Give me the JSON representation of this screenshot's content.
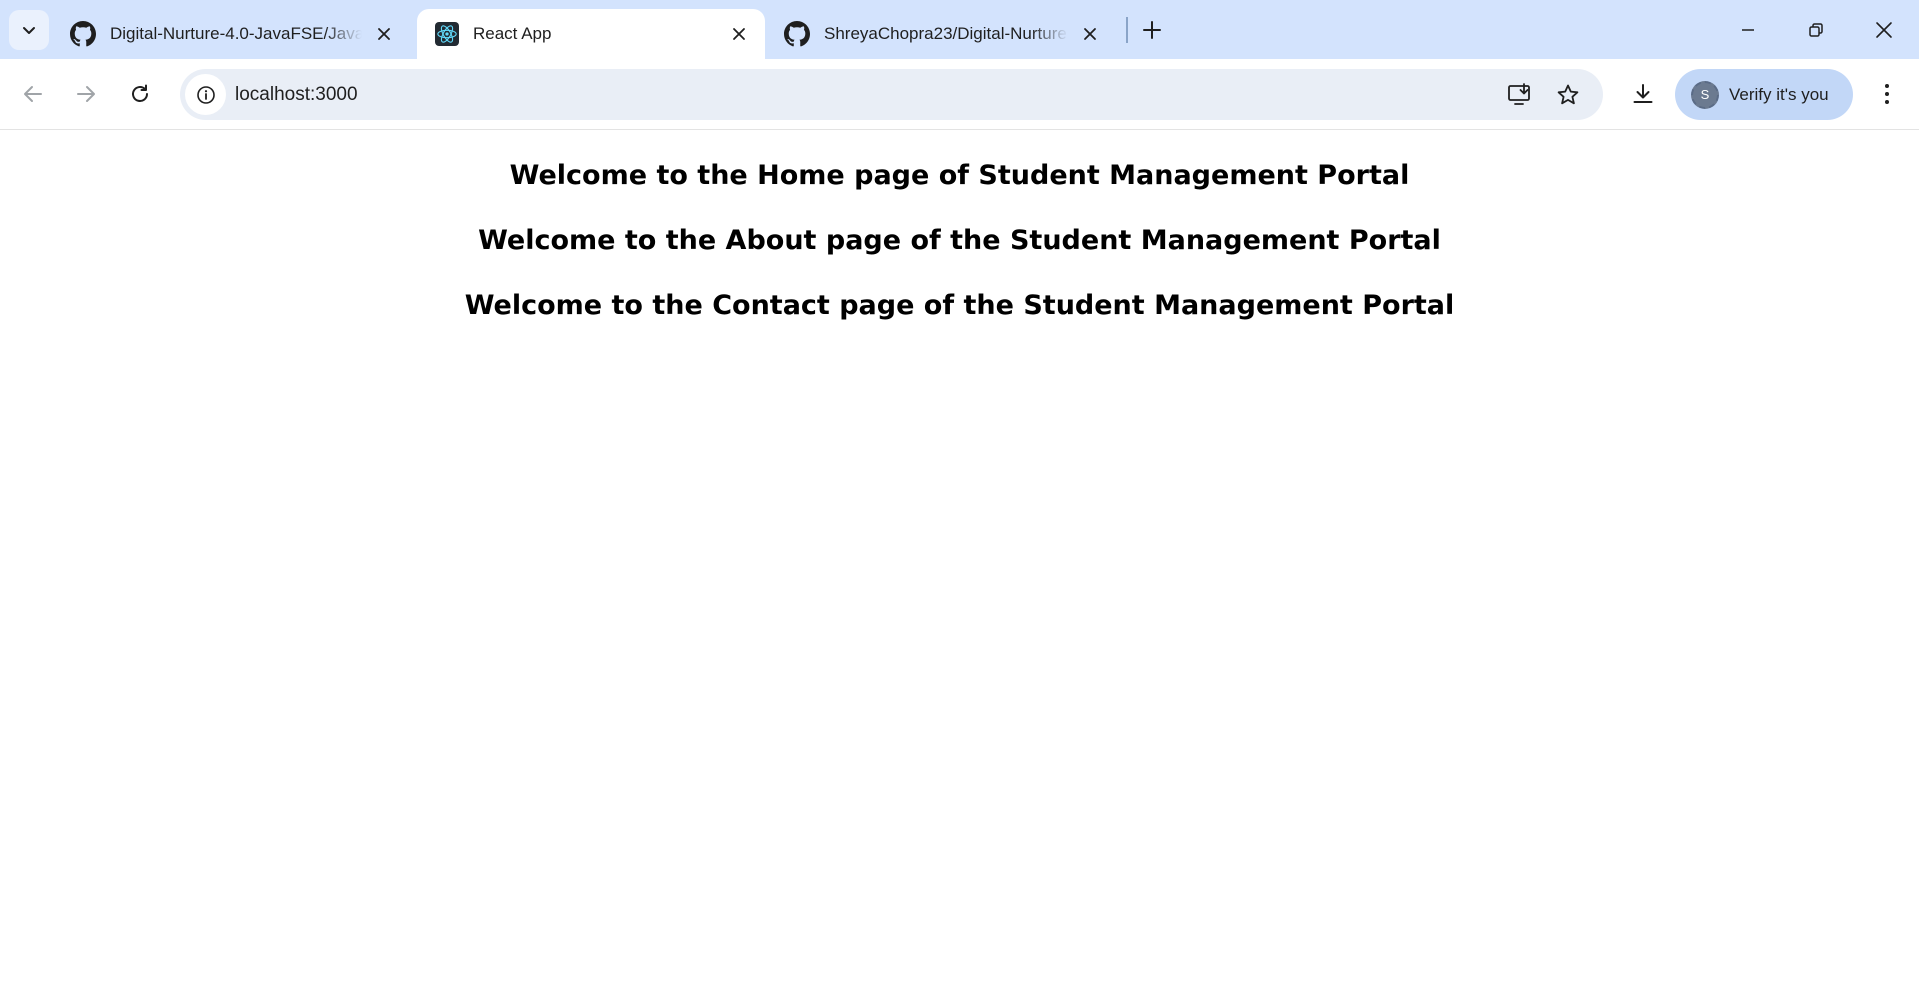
{
  "browser": {
    "tabs": [
      {
        "title": "Digital-Nurture-4.0-JavaFSE/Java",
        "favicon": "github-icon",
        "active": false
      },
      {
        "title": "React App",
        "favicon": "react-icon",
        "active": true
      },
      {
        "title": "ShreyaChopra23/Digital-Nurture",
        "favicon": "github-icon",
        "active": false
      }
    ],
    "address_bar": {
      "url": "localhost:3000"
    },
    "profile": {
      "avatar_initial": "S",
      "label": "Verify it's you"
    },
    "colors": {
      "tabstrip": "#d3e3fd",
      "omnibox": "#e9eef6",
      "profile_chip": "#c2d7f7"
    }
  },
  "page": {
    "headings": [
      "Welcome to the Home page of Student Management Portal",
      "Welcome to the About page of the Student Management Portal",
      "Welcome to the Contact page of the Student Management Portal"
    ]
  }
}
